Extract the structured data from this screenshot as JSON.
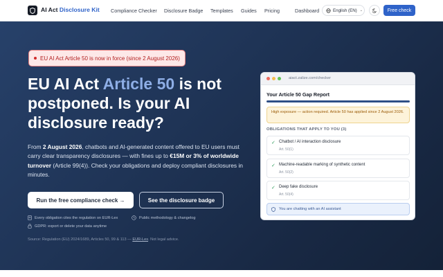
{
  "nav": {
    "brand_prefix": "AI Act",
    "brand_accent": "Disclosure Kit",
    "links": [
      "Compliance Checker",
      "Disclosure Badge",
      "Templates",
      "Guides",
      "Pricing"
    ],
    "dashboard": "Dashboard",
    "language": "English (EN)",
    "cta": "Free check"
  },
  "hero": {
    "alert": "EU AI Act Article 50 is now in force (since 2 August 2026)",
    "headline_pre": "EU AI Act",
    "headline_highlight": "Article 50",
    "headline_post": "is not postponed. Is your AI disclosure ready?",
    "lead": {
      "p1": "From",
      "date": "2 August 2026",
      "p2": ", chatbots and AI-generated content offered to EU users must carry clear transparency disclosures — with fines up to",
      "fine": "€15M or 3% of worldwide turnover",
      "p3": "(Article 99(4)). Check your obligations and deploy compliant disclosures in minutes."
    },
    "primary_button": "Run the free compliance check →",
    "secondary_button": "See the disclosure badge",
    "meta": [
      "Every obligation cites the regulation on EUR-Lex",
      "Public methodology & changelog",
      "GDPR: export or delete your data anytime"
    ],
    "source_prefix": "Source: Regulation (EU) 2024/1689, Articles 50, 99 & 113 —",
    "source_link": "EUR-Lex",
    "source_suffix": ". Not legal advice."
  },
  "report": {
    "url": "aiact.zalize.com/checker",
    "title": "Your Article 50 Gap Report",
    "warning": "High exposure — action required. Article 50 has applied since 2 August 2026.",
    "obligations_heading": "OBLIGATIONS THAT APPLY TO YOU (3)",
    "items": [
      {
        "name": "Chatbot / AI interaction disclosure",
        "article": "Art. 50(1)"
      },
      {
        "name": "Machine-readable marking of synthetic content",
        "article": "Art. 50(2)"
      },
      {
        "name": "Deep fake disclosure",
        "article": "Art. 50(4)"
      }
    ],
    "chat_notice": "You are chatting with an AI assistant"
  },
  "colors": {
    "accent": "#2f63c9",
    "hero_bg": "#1f3456",
    "alert_red": "#b32020",
    "success_green": "#2d9b5a",
    "warning_amber": "#9a5a06"
  },
  "icons": [
    "shield-logo-icon",
    "globe-icon",
    "chevron-down-icon",
    "moon-icon",
    "document-icon",
    "clock-icon",
    "lock-icon",
    "check-icon",
    "shield-icon"
  ]
}
